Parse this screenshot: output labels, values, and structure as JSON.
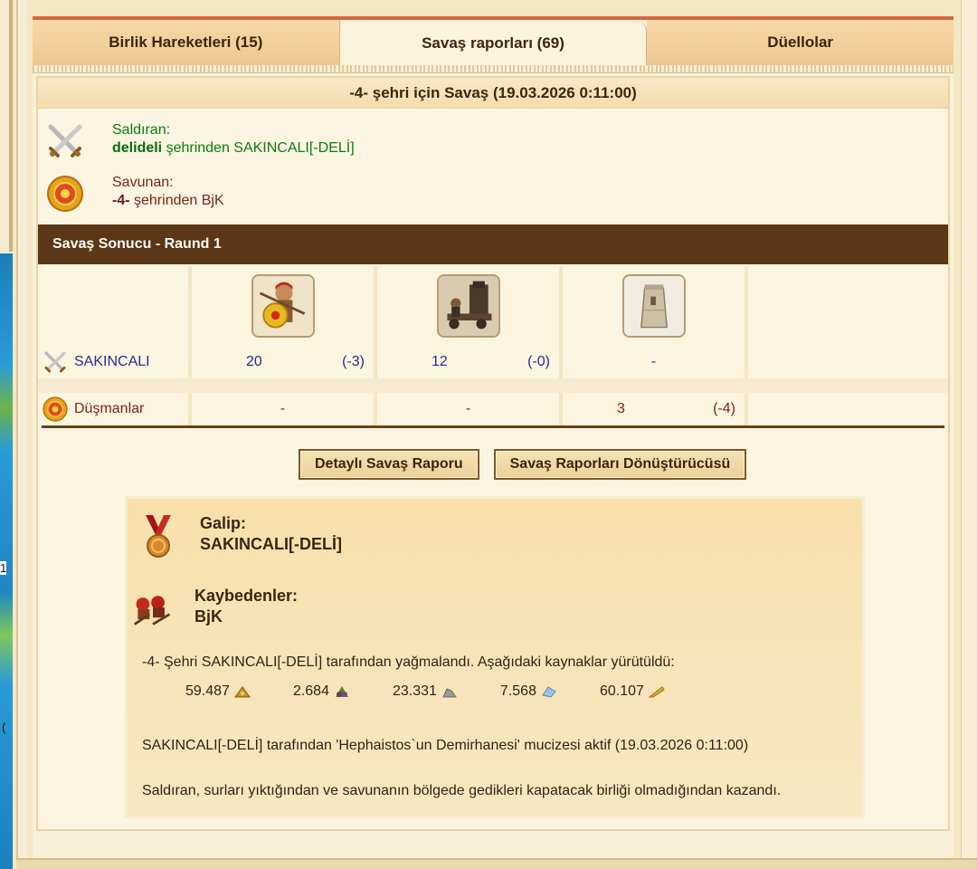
{
  "tabs": [
    {
      "label": "Birlik Hareketleri (15)"
    },
    {
      "label": "Savaş raporları (69)"
    },
    {
      "label": "Düellolar"
    }
  ],
  "report": {
    "title": "-4- şehri için Savaş (19.03.2026 0:11:00)",
    "attacker": {
      "label": "Saldıran:",
      "city": "delideli",
      "suffix": " şehrinden SAKINCALI[-DELİ]"
    },
    "defender": {
      "label": "Savunan:",
      "city": "-4-",
      "suffix": " şehrinden BjK"
    },
    "result_title": "Savaş Sonucu - Raund 1",
    "rows": [
      {
        "name": "SAKINCALI",
        "cells": [
          [
            "20",
            "(-3)"
          ],
          [
            "12",
            "(-0)"
          ],
          [
            "-",
            ""
          ]
        ]
      },
      {
        "name": "Düşmanlar",
        "cells": [
          [
            "-",
            ""
          ],
          [
            "-",
            ""
          ],
          [
            "3",
            "(-4)"
          ]
        ]
      }
    ],
    "buttons": {
      "detail": "Detaylı Savaş Raporu",
      "converter": "Savaş Raporları Dönüştürücüsü"
    },
    "summary": {
      "winner_label": "Galip:",
      "winner": "SAKINCALI[-DELİ]",
      "losers_label": "Kaybedenler:",
      "loser": "BjK",
      "plunder": "-4- Şehri SAKINCALI[-DELİ] tarafından yağmalandı. Aşağıdaki kaynaklar yürütüldü:",
      "resources": [
        {
          "value": "59.487",
          "icon": "gold-icon"
        },
        {
          "value": "2.684",
          "icon": "wood-icon"
        },
        {
          "value": "23.331",
          "icon": "stone-icon"
        },
        {
          "value": "7.568",
          "icon": "marble-icon"
        },
        {
          "value": "60.107",
          "icon": "wheat-icon"
        }
      ],
      "wonder": "SAKINCALI[-DELİ] tarafından 'Hephaistos`un Demirhanesi' mucizesi aktif (19.03.2026 0:11:00)",
      "reason": "Saldıran, surları yıktığından ve savunanın bölgede gedikleri kapatacak birliği olmadığından kazandı."
    }
  },
  "sidebar": {
    "map_labels": [
      "1",
      "("
    ]
  },
  "colors": {
    "accent": "#5b3617",
    "attacker": "#0e7a10",
    "defender": "#7a2418",
    "own_units": "#2a2a9a"
  }
}
